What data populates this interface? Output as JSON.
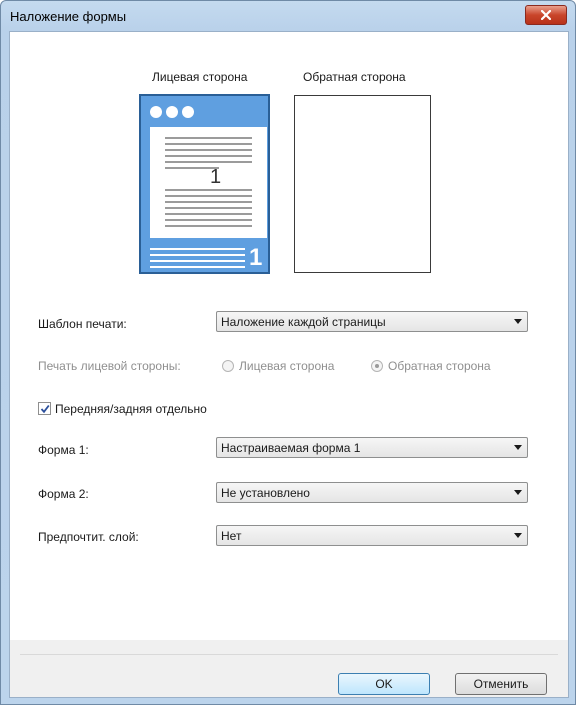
{
  "window": {
    "title": "Наложение формы"
  },
  "preview": {
    "front_caption": "Лицевая сторона",
    "back_caption": "Обратная сторона",
    "front_page_number": "1",
    "front_badge_number": "1"
  },
  "print_template": {
    "label": "Шаблон печати:",
    "value": "Наложение каждой страницы"
  },
  "front_side_print": {
    "label": "Печать лицевой стороны:",
    "options": [
      "Лицевая сторона",
      "Обратная сторона"
    ],
    "selected": "Обратная сторона",
    "disabled": true
  },
  "separate_checkbox": {
    "label": "Передняя/задняя отдельно",
    "checked": true
  },
  "form1": {
    "label": "Форма 1:",
    "value": "Настраиваемая форма 1"
  },
  "form2": {
    "label": "Форма 2:",
    "value": "Не установлено"
  },
  "layer": {
    "label": "Предпочтит. слой:",
    "value": "Нет"
  },
  "buttons": {
    "ok": "OK",
    "cancel": "Отменить"
  },
  "colors": {
    "preview_blue": "#5f9fe0",
    "titlebar": "#c4daef",
    "close": "#c9452a"
  }
}
